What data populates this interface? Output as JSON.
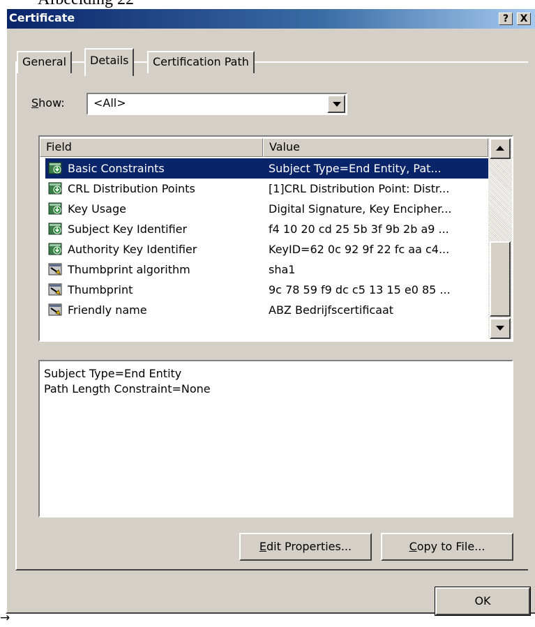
{
  "caption": "Afbeelding 22",
  "window": {
    "title": "Certificate",
    "help_button": "?",
    "close_button": "X"
  },
  "tabs": [
    {
      "label": "General",
      "active": false
    },
    {
      "label": "Details",
      "active": true
    },
    {
      "label": "Certification Path",
      "active": false
    }
  ],
  "show": {
    "label_accel": "S",
    "label_rest": "how:",
    "selected": "<All>"
  },
  "list": {
    "columns": [
      "Field",
      "Value"
    ],
    "rows": [
      {
        "field": "Basic Constraints",
        "value": "Subject Type=End Entity, Pat...",
        "icon": "extension-icon",
        "selected": true
      },
      {
        "field": "CRL Distribution Points",
        "value": "[1]CRL Distribution Point: Distr...",
        "icon": "extension-icon",
        "selected": false
      },
      {
        "field": "Key Usage",
        "value": "Digital Signature, Key Encipher...",
        "icon": "extension-icon",
        "selected": false
      },
      {
        "field": "Subject Key Identifier",
        "value": "f4 10 20 cd 25 5b 3f 9b 2b a9 ...",
        "icon": "extension-icon",
        "selected": false
      },
      {
        "field": "Authority Key Identifier",
        "value": "KeyID=62 0c 92 9f 22 fc aa c4...",
        "icon": "extension-icon",
        "selected": false
      },
      {
        "field": "Thumbprint algorithm",
        "value": "sha1",
        "icon": "property-icon",
        "selected": false
      },
      {
        "field": "Thumbprint",
        "value": "9c 78 59 f9 dc c5 13 15 e0 85 ...",
        "icon": "property-icon",
        "selected": false
      },
      {
        "field": "Friendly name",
        "value": "ABZ Bedrijfscertificaat",
        "icon": "property-icon",
        "selected": false
      }
    ]
  },
  "detail_lines": [
    "Subject Type=End Entity",
    "Path Length Constraint=None"
  ],
  "buttons": {
    "edit_accel": "E",
    "edit_rest": "dit Properties...",
    "copy_accel": "C",
    "copy_rest": "opy to File...",
    "ok": "OK"
  },
  "footnote_arrow": "→"
}
